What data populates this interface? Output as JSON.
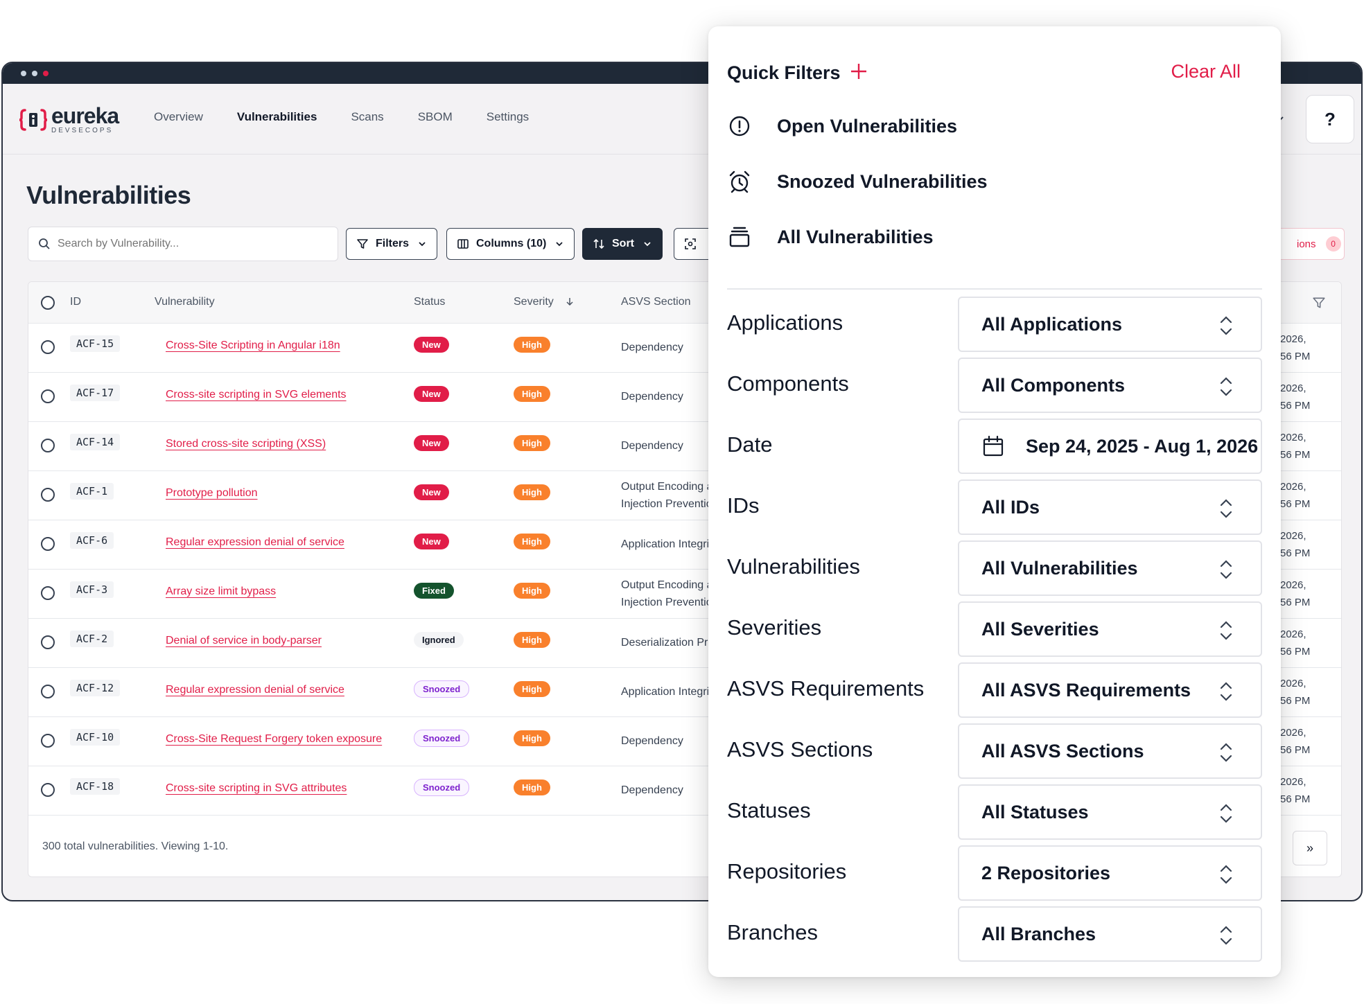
{
  "app": {
    "logo_name": "eureka",
    "logo_sub": "DEVSECOPS",
    "nav": [
      "Overview",
      "Vulnerabilities",
      "Scans",
      "SBOM",
      "Settings"
    ],
    "help_label": "?"
  },
  "page": {
    "title": "Vulnerabilities",
    "search_placeholder": "Search by Vulnerability...",
    "filters_label": "Filters",
    "columns_label": "Columns (10)",
    "sort_label": "Sort",
    "right_pill_label": "ions",
    "right_pill_count": "0"
  },
  "table": {
    "headers": [
      "ID",
      "Vulnerability",
      "Status",
      "Severity",
      "ASVS Section"
    ],
    "rows": [
      {
        "id": "ACF-15",
        "vuln": "Cross-Site Scripting in Angular i18n",
        "status": "New",
        "severity": "High",
        "section": [
          "Dependency"
        ],
        "date": [
          "2026,",
          "56 PM"
        ]
      },
      {
        "id": "ACF-17",
        "vuln": "Cross-site scripting in SVG elements",
        "status": "New",
        "severity": "High",
        "section": [
          "Dependency"
        ],
        "date": [
          "2026,",
          "56 PM"
        ]
      },
      {
        "id": "ACF-14",
        "vuln": "Stored cross-site scripting (XSS)",
        "status": "New",
        "severity": "High",
        "section": [
          "Dependency"
        ],
        "date": [
          "2026,",
          "56 PM"
        ]
      },
      {
        "id": "ACF-1",
        "vuln": "Prototype pollution",
        "status": "New",
        "severity": "High",
        "section": [
          "Output Encoding ar",
          "Injection Prevention"
        ],
        "date": [
          "2026,",
          "56 PM"
        ]
      },
      {
        "id": "ACF-6",
        "vuln": "Regular expression denial of service",
        "status": "New",
        "severity": "High",
        "section": [
          "Application Integrit"
        ],
        "date": [
          "2026,",
          "56 PM"
        ]
      },
      {
        "id": "ACF-3",
        "vuln": "Array size limit bypass",
        "status": "Fixed",
        "severity": "High",
        "section": [
          "Output Encoding ar",
          "Injection Preventio"
        ],
        "date": [
          "2026,",
          "56 PM"
        ]
      },
      {
        "id": "ACF-2",
        "vuln": "Denial of service in body-parser",
        "status": "Ignored",
        "severity": "High",
        "section": [
          "Deserialization Pre"
        ],
        "date": [
          "2026,",
          "56 PM"
        ]
      },
      {
        "id": "ACF-12",
        "vuln": "Regular expression denial of service",
        "status": "Snoozed",
        "severity": "High",
        "section": [
          "Application Integrit"
        ],
        "date": [
          "2026,",
          "56 PM"
        ]
      },
      {
        "id": "ACF-10",
        "vuln": "Cross-Site Request Forgery token exposure",
        "status": "Snoozed",
        "severity": "High",
        "section": [
          "Dependency"
        ],
        "date": [
          "2026,",
          "56 PM"
        ]
      },
      {
        "id": "ACF-18",
        "vuln": "Cross-site scripting in SVG attributes",
        "status": "Snoozed",
        "severity": "High",
        "section": [
          "Dependency"
        ],
        "date": [
          "2026,",
          "56 PM"
        ]
      }
    ],
    "footer": "300 total vulnerabilities. Viewing 1-10.",
    "next_label": "»"
  },
  "quick_filters": {
    "title": "Quick Filters",
    "clear_all": "Clear All",
    "presets": [
      "Open Vulnerabilities",
      "Snoozed Vulnerabilities",
      "All Vulnerabilities"
    ],
    "filters": [
      {
        "label": "Applications",
        "value": "All Applications"
      },
      {
        "label": "Components",
        "value": "All Components"
      },
      {
        "label": "Date",
        "value": "Sep 24, 2025 - Aug 1, 2026"
      },
      {
        "label": "IDs",
        "value": "All IDs"
      },
      {
        "label": "Vulnerabilities",
        "value": "All Vulnerabilities"
      },
      {
        "label": "Severities",
        "value": "All Severities"
      },
      {
        "label": "ASVS Requirements",
        "value": "All ASVS Requirements"
      },
      {
        "label": "ASVS Sections",
        "value": "All ASVS Sections"
      },
      {
        "label": "Statuses",
        "value": "All Statuses"
      },
      {
        "label": "Repositories",
        "value": "2 Repositories"
      },
      {
        "label": "Branches",
        "value": "All Branches"
      }
    ]
  },
  "colors": {
    "accent": "#e11d48",
    "dark": "#1f2937",
    "severity_high": "#f97316",
    "fixed": "#14532d"
  }
}
